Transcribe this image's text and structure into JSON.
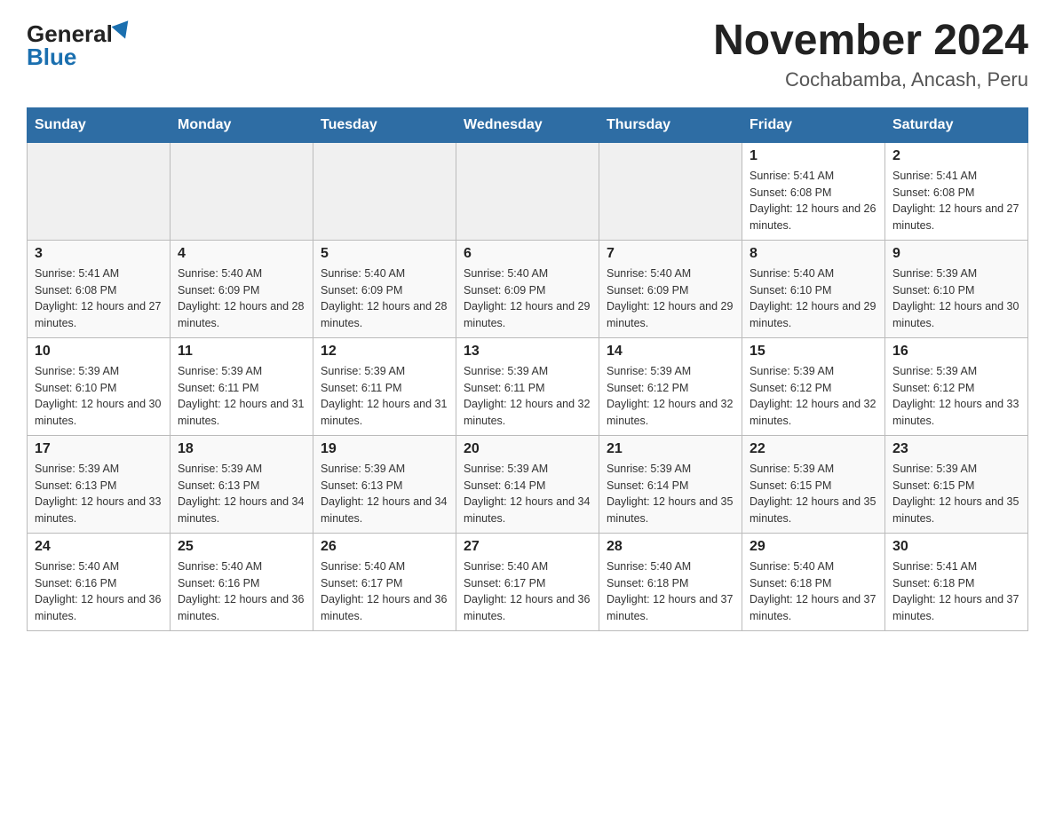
{
  "header": {
    "logo_general": "General",
    "logo_blue": "Blue",
    "title": "November 2024",
    "subtitle": "Cochabamba, Ancash, Peru"
  },
  "days_of_week": [
    "Sunday",
    "Monday",
    "Tuesday",
    "Wednesday",
    "Thursday",
    "Friday",
    "Saturday"
  ],
  "weeks": [
    {
      "days": [
        {
          "num": "",
          "sunrise": "",
          "sunset": "",
          "daylight": "",
          "empty": true
        },
        {
          "num": "",
          "sunrise": "",
          "sunset": "",
          "daylight": "",
          "empty": true
        },
        {
          "num": "",
          "sunrise": "",
          "sunset": "",
          "daylight": "",
          "empty": true
        },
        {
          "num": "",
          "sunrise": "",
          "sunset": "",
          "daylight": "",
          "empty": true
        },
        {
          "num": "",
          "sunrise": "",
          "sunset": "",
          "daylight": "",
          "empty": true
        },
        {
          "num": "1",
          "sunrise": "Sunrise: 5:41 AM",
          "sunset": "Sunset: 6:08 PM",
          "daylight": "Daylight: 12 hours and 26 minutes.",
          "empty": false
        },
        {
          "num": "2",
          "sunrise": "Sunrise: 5:41 AM",
          "sunset": "Sunset: 6:08 PM",
          "daylight": "Daylight: 12 hours and 27 minutes.",
          "empty": false
        }
      ]
    },
    {
      "days": [
        {
          "num": "3",
          "sunrise": "Sunrise: 5:41 AM",
          "sunset": "Sunset: 6:08 PM",
          "daylight": "Daylight: 12 hours and 27 minutes.",
          "empty": false
        },
        {
          "num": "4",
          "sunrise": "Sunrise: 5:40 AM",
          "sunset": "Sunset: 6:09 PM",
          "daylight": "Daylight: 12 hours and 28 minutes.",
          "empty": false
        },
        {
          "num": "5",
          "sunrise": "Sunrise: 5:40 AM",
          "sunset": "Sunset: 6:09 PM",
          "daylight": "Daylight: 12 hours and 28 minutes.",
          "empty": false
        },
        {
          "num": "6",
          "sunrise": "Sunrise: 5:40 AM",
          "sunset": "Sunset: 6:09 PM",
          "daylight": "Daylight: 12 hours and 29 minutes.",
          "empty": false
        },
        {
          "num": "7",
          "sunrise": "Sunrise: 5:40 AM",
          "sunset": "Sunset: 6:09 PM",
          "daylight": "Daylight: 12 hours and 29 minutes.",
          "empty": false
        },
        {
          "num": "8",
          "sunrise": "Sunrise: 5:40 AM",
          "sunset": "Sunset: 6:10 PM",
          "daylight": "Daylight: 12 hours and 29 minutes.",
          "empty": false
        },
        {
          "num": "9",
          "sunrise": "Sunrise: 5:39 AM",
          "sunset": "Sunset: 6:10 PM",
          "daylight": "Daylight: 12 hours and 30 minutes.",
          "empty": false
        }
      ]
    },
    {
      "days": [
        {
          "num": "10",
          "sunrise": "Sunrise: 5:39 AM",
          "sunset": "Sunset: 6:10 PM",
          "daylight": "Daylight: 12 hours and 30 minutes.",
          "empty": false
        },
        {
          "num": "11",
          "sunrise": "Sunrise: 5:39 AM",
          "sunset": "Sunset: 6:11 PM",
          "daylight": "Daylight: 12 hours and 31 minutes.",
          "empty": false
        },
        {
          "num": "12",
          "sunrise": "Sunrise: 5:39 AM",
          "sunset": "Sunset: 6:11 PM",
          "daylight": "Daylight: 12 hours and 31 minutes.",
          "empty": false
        },
        {
          "num": "13",
          "sunrise": "Sunrise: 5:39 AM",
          "sunset": "Sunset: 6:11 PM",
          "daylight": "Daylight: 12 hours and 32 minutes.",
          "empty": false
        },
        {
          "num": "14",
          "sunrise": "Sunrise: 5:39 AM",
          "sunset": "Sunset: 6:12 PM",
          "daylight": "Daylight: 12 hours and 32 minutes.",
          "empty": false
        },
        {
          "num": "15",
          "sunrise": "Sunrise: 5:39 AM",
          "sunset": "Sunset: 6:12 PM",
          "daylight": "Daylight: 12 hours and 32 minutes.",
          "empty": false
        },
        {
          "num": "16",
          "sunrise": "Sunrise: 5:39 AM",
          "sunset": "Sunset: 6:12 PM",
          "daylight": "Daylight: 12 hours and 33 minutes.",
          "empty": false
        }
      ]
    },
    {
      "days": [
        {
          "num": "17",
          "sunrise": "Sunrise: 5:39 AM",
          "sunset": "Sunset: 6:13 PM",
          "daylight": "Daylight: 12 hours and 33 minutes.",
          "empty": false
        },
        {
          "num": "18",
          "sunrise": "Sunrise: 5:39 AM",
          "sunset": "Sunset: 6:13 PM",
          "daylight": "Daylight: 12 hours and 34 minutes.",
          "empty": false
        },
        {
          "num": "19",
          "sunrise": "Sunrise: 5:39 AM",
          "sunset": "Sunset: 6:13 PM",
          "daylight": "Daylight: 12 hours and 34 minutes.",
          "empty": false
        },
        {
          "num": "20",
          "sunrise": "Sunrise: 5:39 AM",
          "sunset": "Sunset: 6:14 PM",
          "daylight": "Daylight: 12 hours and 34 minutes.",
          "empty": false
        },
        {
          "num": "21",
          "sunrise": "Sunrise: 5:39 AM",
          "sunset": "Sunset: 6:14 PM",
          "daylight": "Daylight: 12 hours and 35 minutes.",
          "empty": false
        },
        {
          "num": "22",
          "sunrise": "Sunrise: 5:39 AM",
          "sunset": "Sunset: 6:15 PM",
          "daylight": "Daylight: 12 hours and 35 minutes.",
          "empty": false
        },
        {
          "num": "23",
          "sunrise": "Sunrise: 5:39 AM",
          "sunset": "Sunset: 6:15 PM",
          "daylight": "Daylight: 12 hours and 35 minutes.",
          "empty": false
        }
      ]
    },
    {
      "days": [
        {
          "num": "24",
          "sunrise": "Sunrise: 5:40 AM",
          "sunset": "Sunset: 6:16 PM",
          "daylight": "Daylight: 12 hours and 36 minutes.",
          "empty": false
        },
        {
          "num": "25",
          "sunrise": "Sunrise: 5:40 AM",
          "sunset": "Sunset: 6:16 PM",
          "daylight": "Daylight: 12 hours and 36 minutes.",
          "empty": false
        },
        {
          "num": "26",
          "sunrise": "Sunrise: 5:40 AM",
          "sunset": "Sunset: 6:17 PM",
          "daylight": "Daylight: 12 hours and 36 minutes.",
          "empty": false
        },
        {
          "num": "27",
          "sunrise": "Sunrise: 5:40 AM",
          "sunset": "Sunset: 6:17 PM",
          "daylight": "Daylight: 12 hours and 36 minutes.",
          "empty": false
        },
        {
          "num": "28",
          "sunrise": "Sunrise: 5:40 AM",
          "sunset": "Sunset: 6:18 PM",
          "daylight": "Daylight: 12 hours and 37 minutes.",
          "empty": false
        },
        {
          "num": "29",
          "sunrise": "Sunrise: 5:40 AM",
          "sunset": "Sunset: 6:18 PM",
          "daylight": "Daylight: 12 hours and 37 minutes.",
          "empty": false
        },
        {
          "num": "30",
          "sunrise": "Sunrise: 5:41 AM",
          "sunset": "Sunset: 6:18 PM",
          "daylight": "Daylight: 12 hours and 37 minutes.",
          "empty": false
        }
      ]
    }
  ]
}
